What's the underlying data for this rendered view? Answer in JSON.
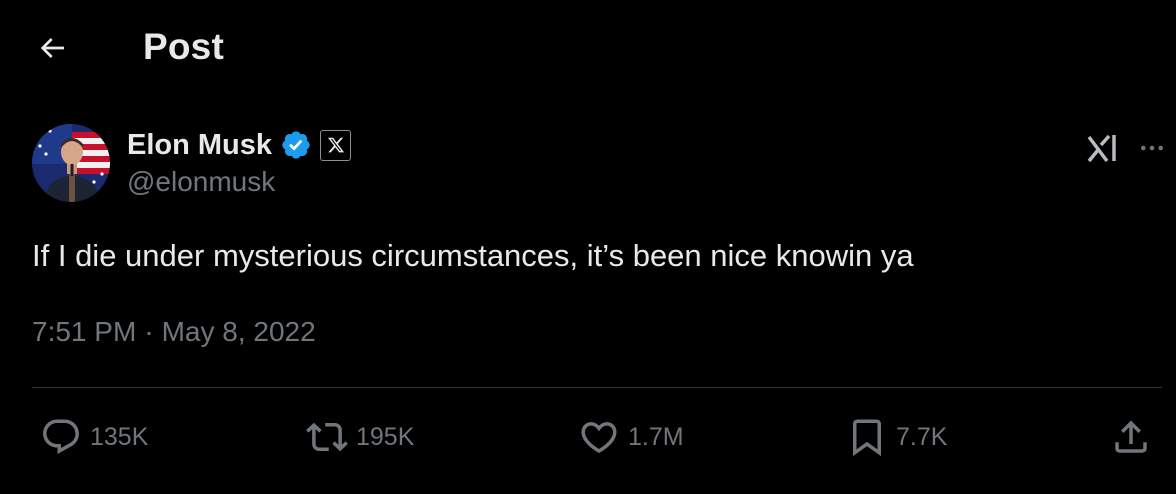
{
  "header": {
    "title": "Post"
  },
  "author": {
    "name": "Elon Musk",
    "handle": "@elonmusk",
    "verified_color": "#1d9bf0",
    "affiliation_badge": "x-logo-icon"
  },
  "post": {
    "text": "If I die under mysterious circumstances, it’s been nice knowin ya",
    "time": "7:51 PM",
    "separator": "·",
    "date": "May 8, 2022"
  },
  "actions": {
    "replies": "135K",
    "reposts": "195K",
    "likes": "1.7M",
    "bookmarks": "7.7K"
  },
  "icons": [
    "back-arrow-icon",
    "verified-badge-icon",
    "x-logo-icon",
    "grok-icon",
    "more-icon",
    "reply-icon",
    "repost-icon",
    "like-icon",
    "bookmark-icon",
    "share-icon"
  ],
  "colors": {
    "background": "#000000",
    "text": "#e7e9ea",
    "secondary": "#71767b",
    "divider": "#2f3336",
    "accent": "#1d9bf0"
  }
}
